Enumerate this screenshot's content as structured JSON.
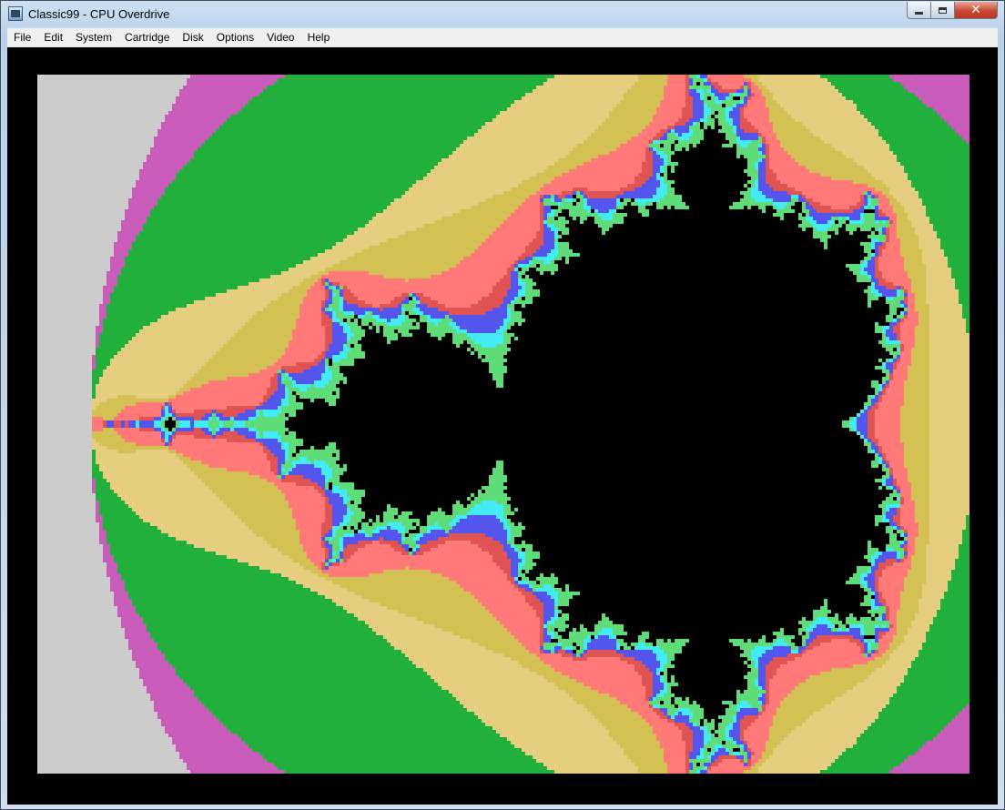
{
  "window": {
    "title": "Classic99 - CPU Overdrive",
    "icon": "classic99-app-icon"
  },
  "controls": {
    "minimize_icon": "minimize-icon",
    "maximize_icon": "maximize-icon",
    "close_icon": "close-icon",
    "close_glyph": "✕"
  },
  "menu": [
    {
      "label": "File"
    },
    {
      "label": "Edit"
    },
    {
      "label": "System"
    },
    {
      "label": "Cartridge"
    },
    {
      "label": "Disk"
    },
    {
      "label": "Options"
    },
    {
      "label": "Video"
    },
    {
      "label": "Help"
    }
  ],
  "display": {
    "content": "mandelbrot-render",
    "palette": [
      "#cccccc",
      "#c95bba",
      "#21b03b",
      "#e6ce80",
      "#d4c154",
      "#fe7978",
      "#e15454",
      "#5455ed",
      "#42ebf5",
      "#5edc78",
      "#000000"
    ]
  }
}
